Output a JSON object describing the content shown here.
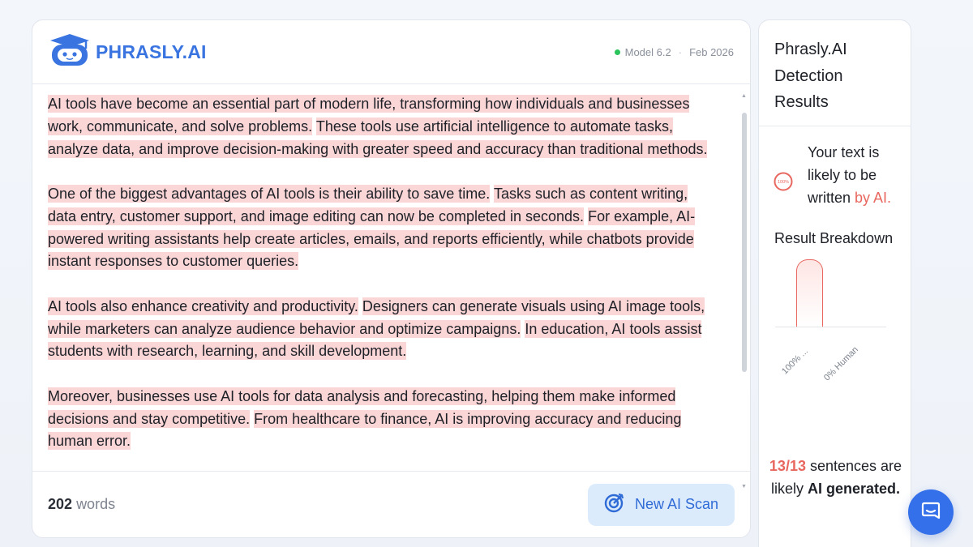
{
  "brand": {
    "name": "PHRASLY.AI"
  },
  "model": {
    "version": "Model 6.2",
    "separator": "·",
    "date": "Feb 2026",
    "status_color": "#2bc35b"
  },
  "paragraphs": [
    [
      "AI tools have become an essential part of modern life, transforming how individuals and businesses work, communicate, and solve problems.",
      "These tools use artificial intelligence to automate tasks, analyze data, and improve decision-making with greater speed and accuracy than traditional methods."
    ],
    [
      "One of the biggest advantages of AI tools is their ability to save time.",
      "Tasks such as content writing, data entry, customer support, and image editing can now be completed in seconds.",
      "For example, AI-powered writing assistants help create articles, emails, and reports efficiently, while chatbots provide instant responses to customer queries."
    ],
    [
      "AI tools also enhance creativity and productivity.",
      "Designers can generate visuals using AI image tools, while marketers can analyze audience behavior and optimize campaigns.",
      "In education, AI tools assist students with research, learning, and skill development."
    ],
    [
      "Moreover, businesses use AI tools for data analysis and forecasting, helping them make informed decisions and stay competitive.",
      "From healthcare to finance, AI is improving accuracy and reducing human error."
    ]
  ],
  "footer": {
    "word_count": "202",
    "word_suffix": "words",
    "scan_button": "New AI Scan"
  },
  "results": {
    "title": "Phrasly.AI Detection Results",
    "verdict_icon_label": "100%",
    "verdict_prefix": "Your text is likely to be written",
    "verdict_highlight": "by AI.",
    "breakdown_label": "Result Breakdown",
    "ai_percent": 100,
    "tick_ai": "100% ...",
    "tick_human": "0% Human",
    "summary_count": "13/13",
    "summary_mid": "sentences are likely",
    "summary_bold": "AI generated."
  },
  "colors": {
    "accent": "#3470ea",
    "ai_red": "#e8675f",
    "highlight": "#fbd6d6",
    "button_bg": "#dcebfb"
  },
  "icons": {
    "logo": "robot-graduate-icon",
    "scan": "target-scan-icon",
    "chat": "chat-bubble-icon"
  }
}
